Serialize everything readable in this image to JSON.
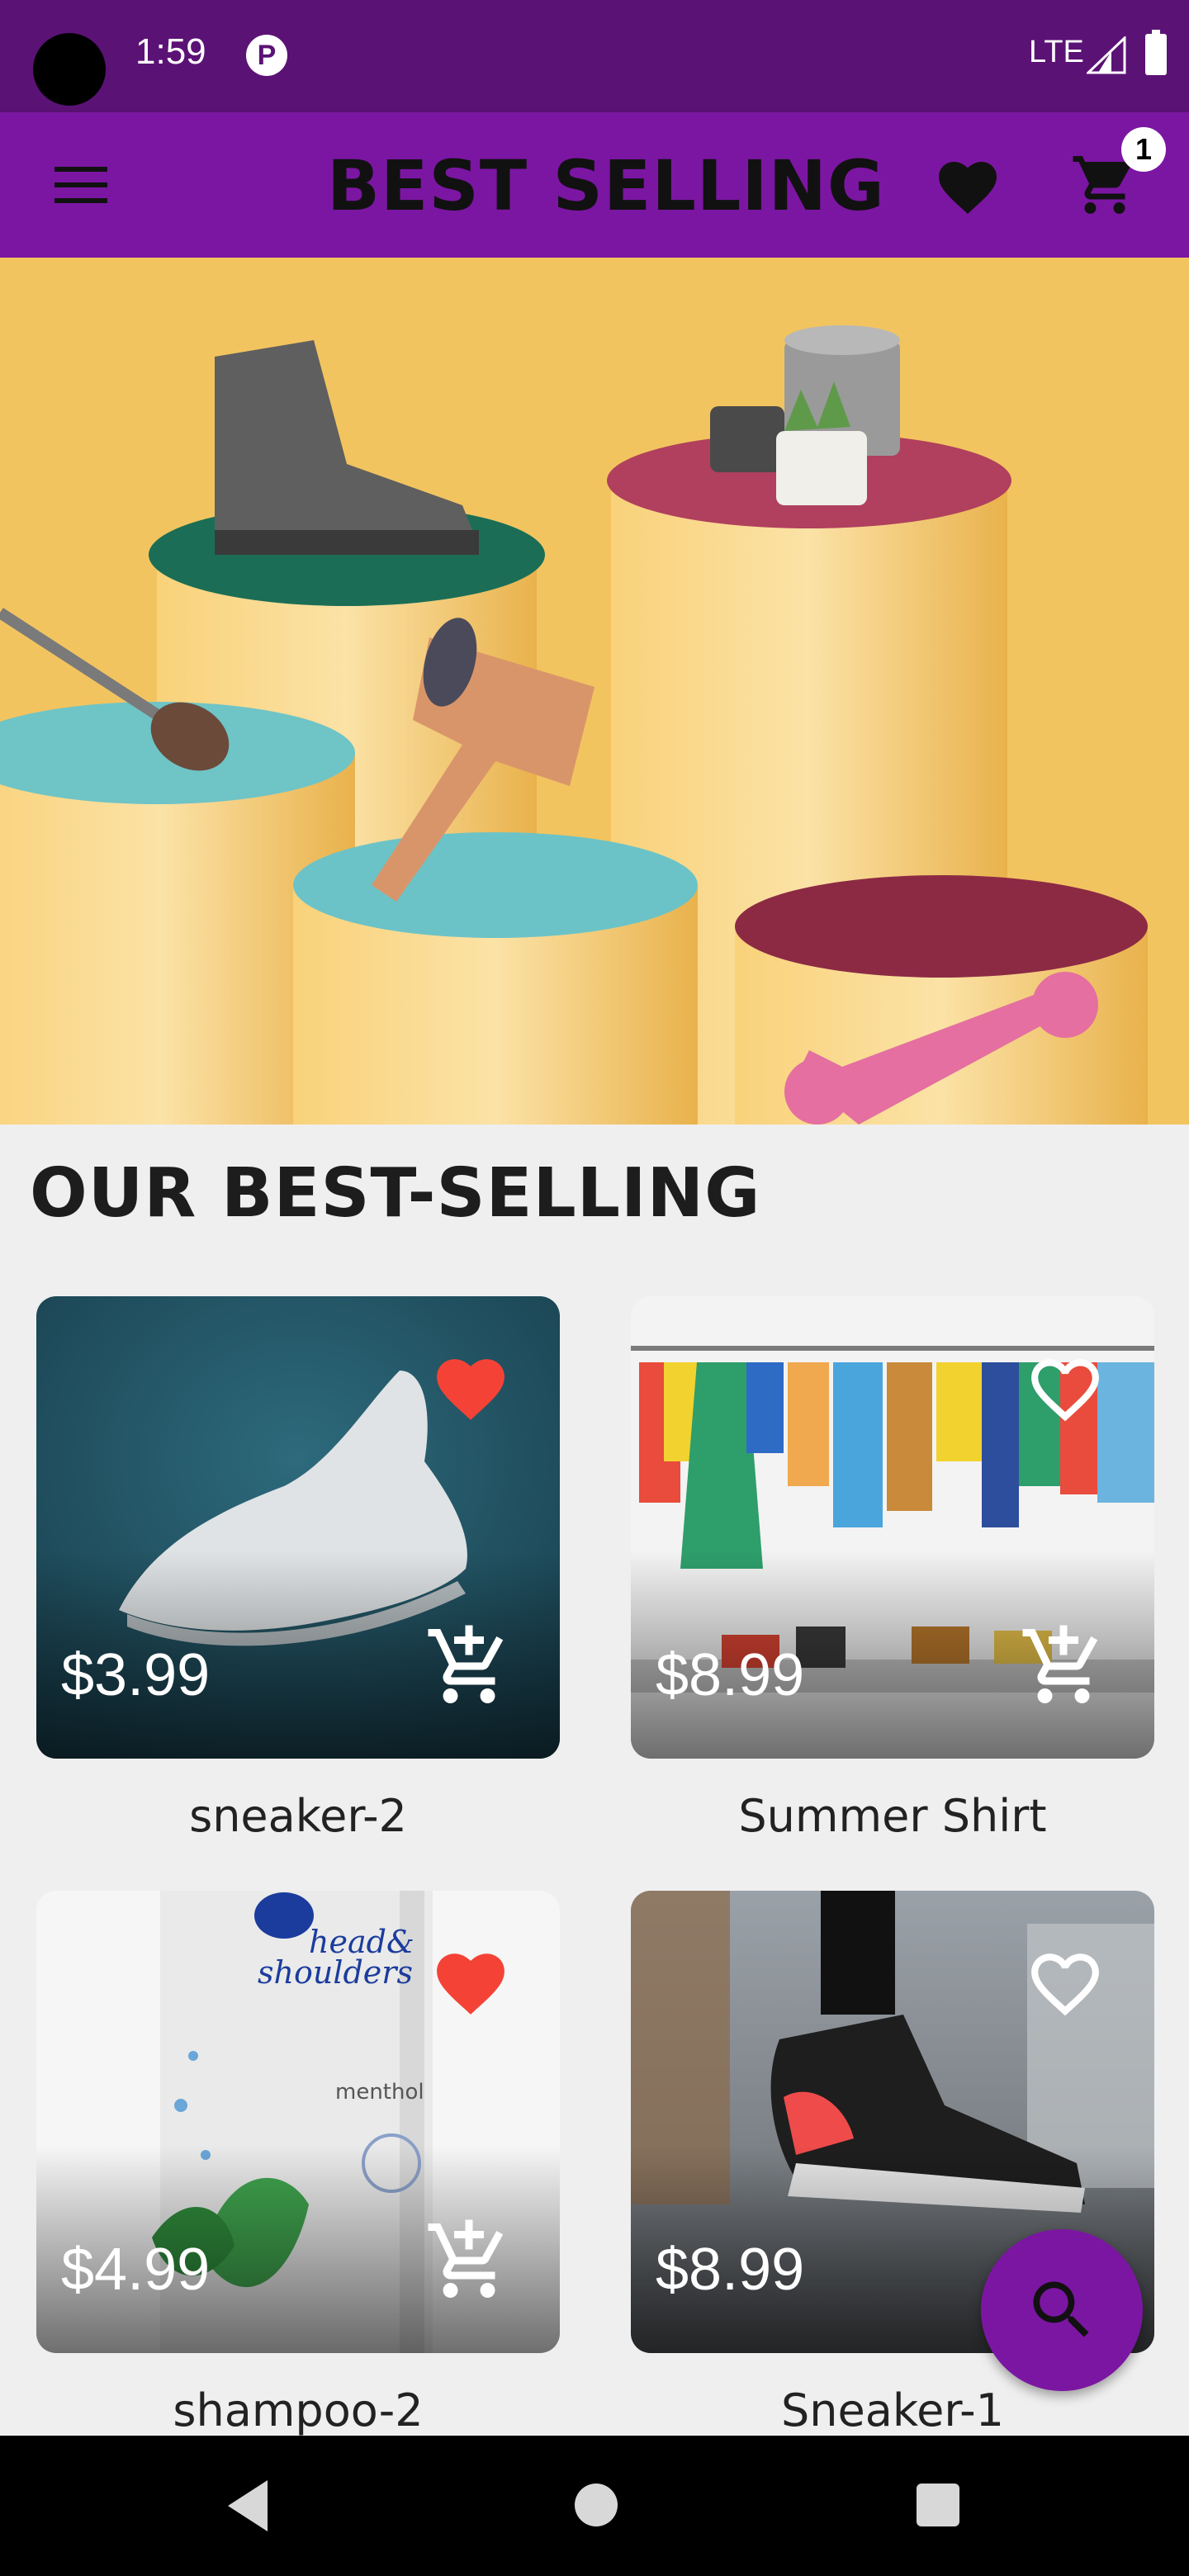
{
  "status_bar": {
    "time": "1:59",
    "network": "LTE",
    "icons": [
      "camera-cutout",
      "p-icon",
      "signal-icon",
      "battery-icon"
    ]
  },
  "app_bar": {
    "title": "BEST SELLING",
    "cart_count": "1",
    "icons": [
      "menu-icon",
      "heart-icon",
      "cart-icon"
    ],
    "accent_color": "#7b16a2"
  },
  "hero": {
    "description_icons": [
      "boot",
      "plant-pots",
      "brush",
      "hair-dryer",
      "dog-bone-toy"
    ]
  },
  "section": {
    "title": "OUR BEST-SELLING"
  },
  "products": [
    {
      "name": "sneaker-2",
      "price": "$3.99",
      "favorite": true
    },
    {
      "name": "Summer Shirt",
      "price": "$8.99",
      "favorite": false
    },
    {
      "name": "shampoo-2",
      "price": "$4.99",
      "favorite": true,
      "brand_text": "head & shoulders",
      "variant_text": "menthol"
    },
    {
      "name": "Sneaker-1",
      "price": "$8.99",
      "favorite": false
    }
  ],
  "fab": {
    "icon": "search-icon"
  },
  "nav_bar": {
    "icons": [
      "back-icon",
      "home-icon",
      "recents-icon"
    ]
  },
  "colors": {
    "favorite_red": "#f44336",
    "status_bar": "#5b1275"
  }
}
